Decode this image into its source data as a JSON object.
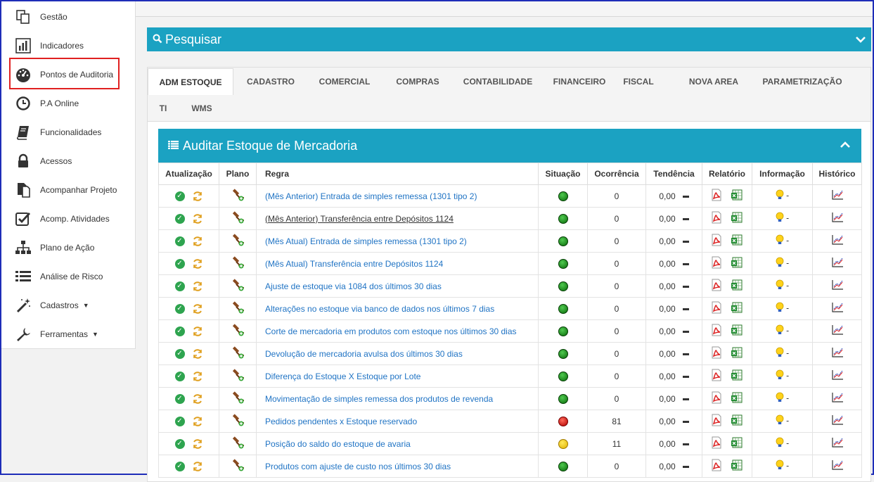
{
  "sidebar": {
    "items": [
      {
        "label": "Gestão",
        "icon": "copy-icon"
      },
      {
        "label": "Indicadores",
        "icon": "bar-chart-icon"
      },
      {
        "label": "Pontos de Auditoria",
        "icon": "dashboard-icon"
      },
      {
        "label": "P.A Online",
        "icon": "clock-icon"
      },
      {
        "label": "Funcionalidades",
        "icon": "book-icon"
      },
      {
        "label": "Acessos",
        "icon": "lock-icon"
      },
      {
        "label": "Acompanhar Projeto",
        "icon": "document-icon"
      },
      {
        "label": "Acomp. Atividades",
        "icon": "checkbox-icon"
      },
      {
        "label": "Plano de Ação",
        "icon": "sitemap-icon"
      },
      {
        "label": "Análise de Risco",
        "icon": "list-icon"
      },
      {
        "label": "Cadastros",
        "icon": "magic-wand-icon"
      },
      {
        "label": "Ferramentas",
        "icon": "wrench-icon"
      }
    ]
  },
  "search": {
    "title": "Pesquisar"
  },
  "tabs": [
    "ADM ESTOQUE",
    "CADASTRO",
    "COMERCIAL",
    "COMPRAS",
    "CONTABILIDADE",
    "FINANCEIRO",
    "FISCAL",
    "NOVA AREA",
    "PARAMETRIZAÇÃO",
    "TI",
    "WMS"
  ],
  "section": {
    "title": "Auditar Estoque de Mercadoria"
  },
  "table": {
    "headers": [
      "Atualização",
      "Plano",
      "Regra",
      "Situação",
      "Ocorrência",
      "Tendência",
      "Relatório",
      "Informação",
      "Histórico"
    ],
    "info_suffix": "-",
    "rows": [
      {
        "regra": "(Mês Anterior) Entrada de simples remessa (1301 tipo 2)",
        "situacao": "green",
        "ocorrencia": "0",
        "tendencia": "0,00"
      },
      {
        "regra": "(Mês Anterior) Transferência entre Depósitos 1124",
        "situacao": "green",
        "ocorrencia": "0",
        "tendencia": "0,00"
      },
      {
        "regra": "(Mês Atual) Entrada de simples remessa (1301 tipo 2)",
        "situacao": "green",
        "ocorrencia": "0",
        "tendencia": "0,00"
      },
      {
        "regra": "(Mês Atual) Transferência entre Depósitos 1124",
        "situacao": "green",
        "ocorrencia": "0",
        "tendencia": "0,00"
      },
      {
        "regra": "Ajuste de estoque via 1084 dos últimos 30 dias",
        "situacao": "green",
        "ocorrencia": "0",
        "tendencia": "0,00"
      },
      {
        "regra": "Alterações no estoque via banco de dados nos últimos 7 dias",
        "situacao": "green",
        "ocorrencia": "0",
        "tendencia": "0,00"
      },
      {
        "regra": "Corte de mercadoria em produtos com estoque nos últimos 30 dias",
        "situacao": "green",
        "ocorrencia": "0",
        "tendencia": "0,00"
      },
      {
        "regra": "Devolução de mercadoria avulsa dos últimos 30 dias",
        "situacao": "green",
        "ocorrencia": "0",
        "tendencia": "0,00"
      },
      {
        "regra": "Diferença do Estoque X Estoque por Lote",
        "situacao": "green",
        "ocorrencia": "0",
        "tendencia": "0,00"
      },
      {
        "regra": "Movimentação de simples remessa dos produtos de revenda",
        "situacao": "green",
        "ocorrencia": "0",
        "tendencia": "0,00"
      },
      {
        "regra": "Pedidos pendentes x Estoque reservado",
        "situacao": "red",
        "ocorrencia": "81",
        "tendencia": "0,00"
      },
      {
        "regra": "Posição do saldo do estoque de avaria",
        "situacao": "yellow",
        "ocorrencia": "11",
        "tendencia": "0,00"
      },
      {
        "regra": "Produtos com ajuste de custo nos últimos 30 dias",
        "situacao": "green",
        "ocorrencia": "0",
        "tendencia": "0,00"
      }
    ]
  },
  "colors": {
    "accent": "#1ba2c2",
    "link": "#1f73c4",
    "highlight": "#e02020",
    "window_border": "#1e2db8"
  }
}
